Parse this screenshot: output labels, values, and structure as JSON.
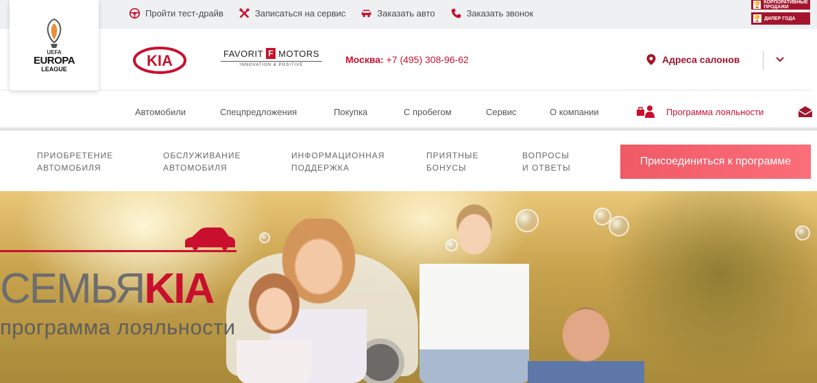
{
  "top_bar": {
    "actions": [
      {
        "label": "Пройти тест-драйв",
        "icon": "steering-wheel-icon"
      },
      {
        "label": "Записаться на сервис",
        "icon": "tools-icon"
      },
      {
        "label": "Заказать авто",
        "icon": "car-icon"
      },
      {
        "label": "Заказать звонок",
        "icon": "phone-icon"
      }
    ],
    "awards": [
      {
        "label": "КОРПОРАТИВНЫЕ ПРОДАЖИ",
        "icon": "trophy-icon"
      },
      {
        "label": "ДИЛЕР ГОДА",
        "icon": "trophy-icon"
      }
    ]
  },
  "header": {
    "europa": {
      "uefa": "UEFA",
      "title": "EUROPA",
      "league": "LEAGUE"
    },
    "kia_logo_text": "KIA",
    "dealer": {
      "name_left": "FAVORIT",
      "letter": "F",
      "name_right": "MOTORS",
      "tagline": "INNOVATION & POSITIVE"
    },
    "phone_city": "Москва:",
    "phone_number": "+7 (495) 308-96-62",
    "salons_label": "Адреса салонов"
  },
  "main_nav": {
    "items": [
      "Автомобили",
      "Спецпредложения",
      "Покупка",
      "С пробегом",
      "Сервис",
      "О компании"
    ],
    "loyalty": "Программа лояльности"
  },
  "sub_nav": {
    "items": [
      {
        "line1": "ПРИОБРЕТЕНИЕ",
        "line2": "АВТОМОБИЛЯ"
      },
      {
        "line1": "ОБСЛУЖИВАНИЕ",
        "line2": "АВТОМОБИЛЯ"
      },
      {
        "line1": "ИНФОРМАЦИОННАЯ",
        "line2": "ПОДДЕРЖКА"
      },
      {
        "line1": "ПРИЯТНЫЕ",
        "line2": "БОНУСЫ"
      },
      {
        "line1": "ВОПРОСЫ",
        "line2": "И ОТВЕТЫ"
      }
    ],
    "join_button": "Присоединиться к программе"
  },
  "hero": {
    "title_part1": "СЕМЬЯ",
    "title_part2": "KIA",
    "subtitle": "программа лояльности"
  },
  "colors": {
    "brand_red": "#c8102e",
    "button": "#f25c68",
    "award": "#a3152c"
  }
}
